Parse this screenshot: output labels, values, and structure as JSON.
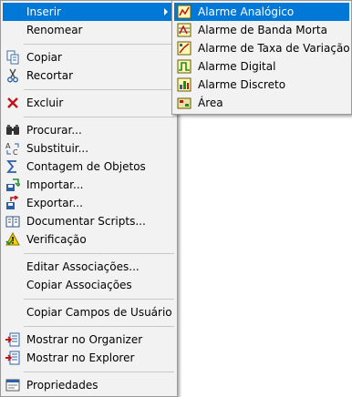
{
  "main_menu": {
    "items": [
      {
        "label": "Inserir"
      },
      {
        "label": "Renomear"
      },
      {
        "label": "Copiar"
      },
      {
        "label": "Recortar"
      },
      {
        "label": "Excluir"
      },
      {
        "label": "Procurar..."
      },
      {
        "label": "Substituir..."
      },
      {
        "label": "Contagem de Objetos"
      },
      {
        "label": "Importar..."
      },
      {
        "label": "Exportar..."
      },
      {
        "label": "Documentar Scripts..."
      },
      {
        "label": "Verificação"
      },
      {
        "label": "Editar Associações..."
      },
      {
        "label": "Copiar Associações"
      },
      {
        "label": "Copiar Campos de Usuário"
      },
      {
        "label": "Mostrar no Organizer"
      },
      {
        "label": "Mostrar no Explorer"
      },
      {
        "label": "Propriedades"
      }
    ]
  },
  "sub_menu": {
    "items": [
      {
        "label": "Alarme Analógico"
      },
      {
        "label": "Alarme de Banda Morta"
      },
      {
        "label": "Alarme de Taxa de Variação"
      },
      {
        "label": "Alarme Digital"
      },
      {
        "label": "Alarme Discreto"
      },
      {
        "label": "Área"
      }
    ]
  },
  "colors": {
    "highlight": "#0078d7",
    "menu_bg": "#f2f2f2"
  }
}
